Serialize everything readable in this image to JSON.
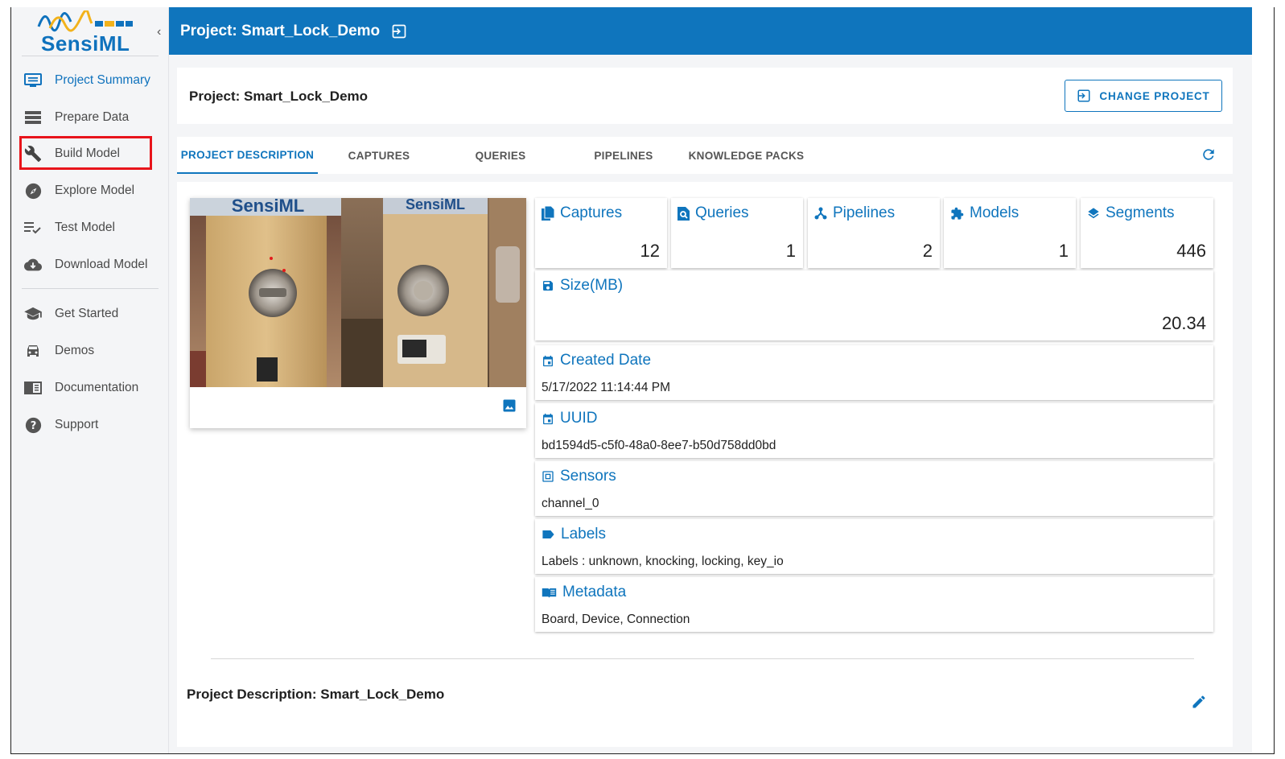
{
  "brand": {
    "name": "SensiML"
  },
  "sidebar": {
    "items": [
      {
        "label": "Project Summary",
        "icon": "project-summary-icon"
      },
      {
        "label": "Prepare Data",
        "icon": "prepare-data-icon"
      },
      {
        "label": "Build Model",
        "icon": "wrench-icon"
      },
      {
        "label": "Explore Model",
        "icon": "compass-icon"
      },
      {
        "label": "Test Model",
        "icon": "test-list-icon"
      },
      {
        "label": "Download Model",
        "icon": "cloud-download-icon"
      }
    ],
    "help_items": [
      {
        "label": "Get Started",
        "icon": "graduation-cap-icon"
      },
      {
        "label": "Demos",
        "icon": "car-icon"
      },
      {
        "label": "Documentation",
        "icon": "book-icon"
      },
      {
        "label": "Support",
        "icon": "help-circle-icon"
      }
    ]
  },
  "header": {
    "title": "Project: Smart_Lock_Demo"
  },
  "project_card": {
    "title": "Project: Smart_Lock_Demo",
    "change_button": "CHANGE PROJECT"
  },
  "tabs": [
    "PROJECT DESCRIPTION",
    "CAPTURES",
    "QUERIES",
    "PIPELINES",
    "KNOWLEDGE PACKS"
  ],
  "photo": {
    "caption_left": "SensiML",
    "caption_right": "SensiML"
  },
  "stats": [
    {
      "label": "Captures",
      "value": "12"
    },
    {
      "label": "Queries",
      "value": "1"
    },
    {
      "label": "Pipelines",
      "value": "2"
    },
    {
      "label": "Models",
      "value": "1"
    },
    {
      "label": "Segments",
      "value": "446"
    }
  ],
  "size": {
    "label": "Size(MB)",
    "value": "20.34"
  },
  "info": [
    {
      "label": "Created Date",
      "value": "5/17/2022 11:14:44 PM"
    },
    {
      "label": "UUID",
      "value": "bd1594d5-c5f0-48a0-8ee7-b50d758dd0bd"
    },
    {
      "label": "Sensors",
      "value": "channel_0"
    },
    {
      "label": "Labels",
      "value": "Labels : unknown, knocking, locking, key_io"
    },
    {
      "label": "Metadata",
      "value": "Board, Device, Connection"
    }
  ],
  "description": {
    "title": "Project Description: Smart_Lock_Demo"
  },
  "colors": {
    "primary": "#0f75bd",
    "highlight": "#e8141b",
    "sidebar_bg": "#f4f5f7"
  }
}
